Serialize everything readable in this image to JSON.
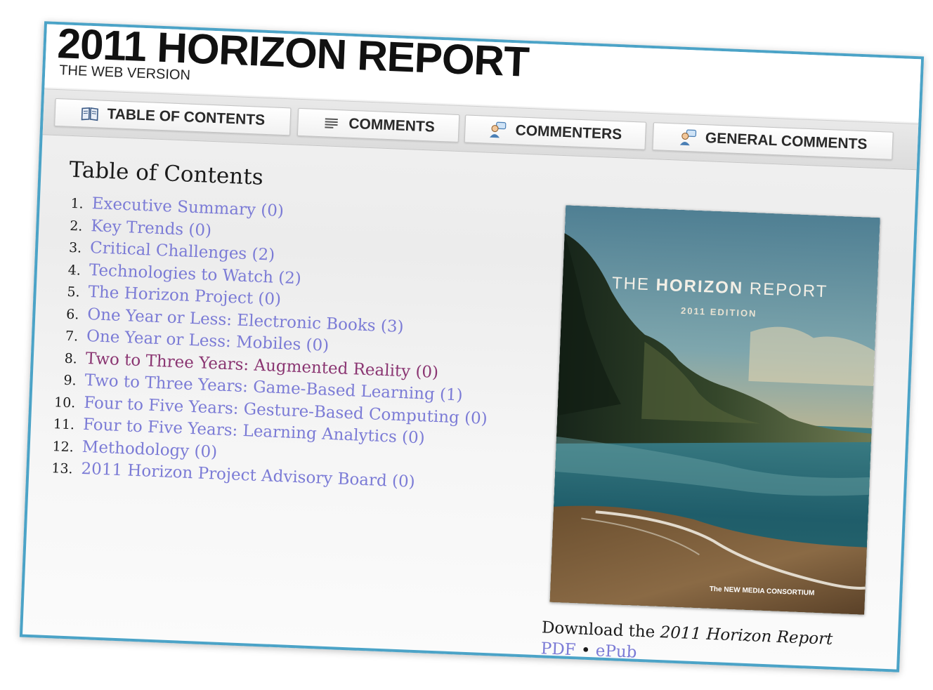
{
  "header": {
    "title": "2011 HORIZON REPORT",
    "subtitle": "THE WEB VERSION"
  },
  "tabs": [
    {
      "label": "TABLE OF CONTENTS",
      "icon": "book-icon"
    },
    {
      "label": "COMMENTS",
      "icon": "comment-lines-icon"
    },
    {
      "label": "COMMENTERS",
      "icon": "user-speech-icon"
    },
    {
      "label": "GENERAL COMMENTS",
      "icon": "user-speech-icon"
    }
  ],
  "toc": {
    "heading": "Table of Contents",
    "items": [
      {
        "num": "1.",
        "label": "Executive Summary (0)"
      },
      {
        "num": "2.",
        "label": "Key Trends (0)"
      },
      {
        "num": "3.",
        "label": "Critical Challenges (2)"
      },
      {
        "num": "4.",
        "label": "Technologies to Watch (2)"
      },
      {
        "num": "5.",
        "label": "The Horizon Project (0)"
      },
      {
        "num": "6.",
        "label": "One Year or Less: Electronic Books (3)"
      },
      {
        "num": "7.",
        "label": "One Year or Less: Mobiles (0)"
      },
      {
        "num": "8.",
        "label": "Two to Three Years: Augmented Reality (0)"
      },
      {
        "num": "9.",
        "label": "Two to Three Years: Game-Based Learning (1)"
      },
      {
        "num": "10.",
        "label": "Four to Five Years: Gesture-Based Computing (0)"
      },
      {
        "num": "11.",
        "label": "Four to Five Years: Learning Analytics (0)"
      },
      {
        "num": "12.",
        "label": "Methodology (0)"
      },
      {
        "num": "13.",
        "label": "2011 Horizon Project Advisory Board (0)"
      }
    ]
  },
  "cover": {
    "title_light": "THE",
    "title_bold": "HORIZON",
    "title_end": "REPORT",
    "edition": "2011 EDITION",
    "publisher": "The NEW MEDIA CONSORTIUM"
  },
  "download": {
    "prefix": "Download the",
    "report": "2011 Horizon Report",
    "pdf": "PDF",
    "separator": "•",
    "epub": "ePub"
  },
  "colors": {
    "link": "#7b7bd6",
    "visited_link": "#8a3572",
    "frame": "#4ba3c7"
  }
}
